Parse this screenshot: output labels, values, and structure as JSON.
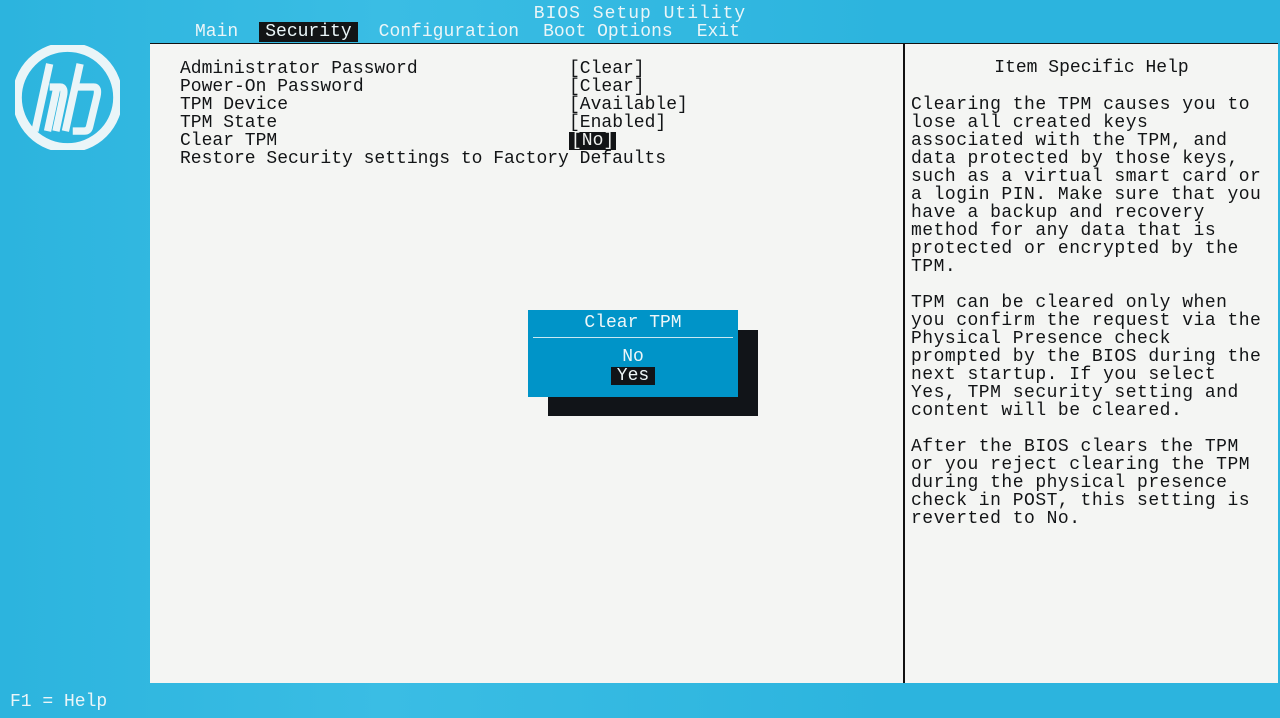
{
  "title": "BIOS Setup Utility",
  "brand": "hp",
  "menu": {
    "items": [
      "Main",
      "Security",
      "Configuration",
      "Boot Options",
      "Exit"
    ],
    "active_index": 1
  },
  "settings": [
    {
      "label": "Administrator Password",
      "value": "[Clear]",
      "highlight": false
    },
    {
      "label": "Power-On Password",
      "value": "[Clear]",
      "highlight": false
    },
    {
      "label": "TPM Device",
      "value": "[Available]",
      "highlight": false
    },
    {
      "label": "TPM State",
      "value": "[Enabled]",
      "highlight": false
    },
    {
      "label": "Clear TPM",
      "value": "[No]",
      "highlight": true
    },
    {
      "label": "Restore Security settings to Factory Defaults",
      "value": "",
      "highlight": false
    }
  ],
  "dialog": {
    "title": "Clear TPM",
    "options": [
      "No",
      "Yes"
    ],
    "selected_index": 1
  },
  "help": {
    "title": "Item Specific Help",
    "paragraphs": [
      "Clearing the TPM causes you to lose all created keys associated with the TPM, and data protected by those keys, such as a virtual smart card or a login PIN. Make sure that you have a backup and recovery method for any data that is protected or encrypted by the TPM.",
      "TPM can be cleared only when you confirm the request via the Physical Presence check prompted by the BIOS during the next startup. If you select Yes, TPM security setting and content will be cleared.",
      "After the BIOS clears the TPM or you reject clearing the TPM during the physical presence check in POST, this setting is reverted to No."
    ]
  },
  "footer": "F1 = Help"
}
